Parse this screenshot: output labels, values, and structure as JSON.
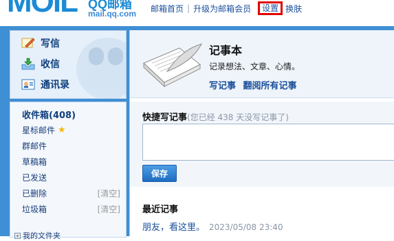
{
  "header": {
    "logo_big": "MOIL",
    "logo_qq": "QQ邮箱",
    "logo_domain": "mail.qq.com",
    "nav": {
      "home": "邮箱首页",
      "upgrade": "升级为邮箱会员",
      "settings": "设置",
      "skin": "换肤"
    },
    "accent_color": "#1b8bd6",
    "highlight_color": "#e20000"
  },
  "sidebar": {
    "actions": [
      {
        "label": "写信",
        "icon": "compose-icon"
      },
      {
        "label": "收信",
        "icon": "inbox-download-icon"
      },
      {
        "label": "通讯录",
        "icon": "address-book-icon"
      }
    ],
    "folders": {
      "inbox": "收件箱(408)",
      "starred": "星标邮件",
      "group": "群邮件",
      "drafts": "草稿箱",
      "sent": "已发送",
      "deleted": "已删除",
      "spam": "垃圾箱",
      "clear_label": "[清空]",
      "my_folders": "我的文件夹"
    }
  },
  "main": {
    "notebook": {
      "title": "记事本",
      "subtitle": "记录想法、文章、心情。",
      "write_link": "写记事",
      "browse_link": "翻阅所有记事"
    },
    "quick": {
      "title": "快捷写记事",
      "hint": "(您已经 438 天没写记事了)",
      "save": "保存"
    },
    "recent": {
      "title": "最近记事",
      "items": [
        {
          "text": "朋友，看这里。",
          "date": "2023/05/08 23:40"
        }
      ]
    }
  }
}
